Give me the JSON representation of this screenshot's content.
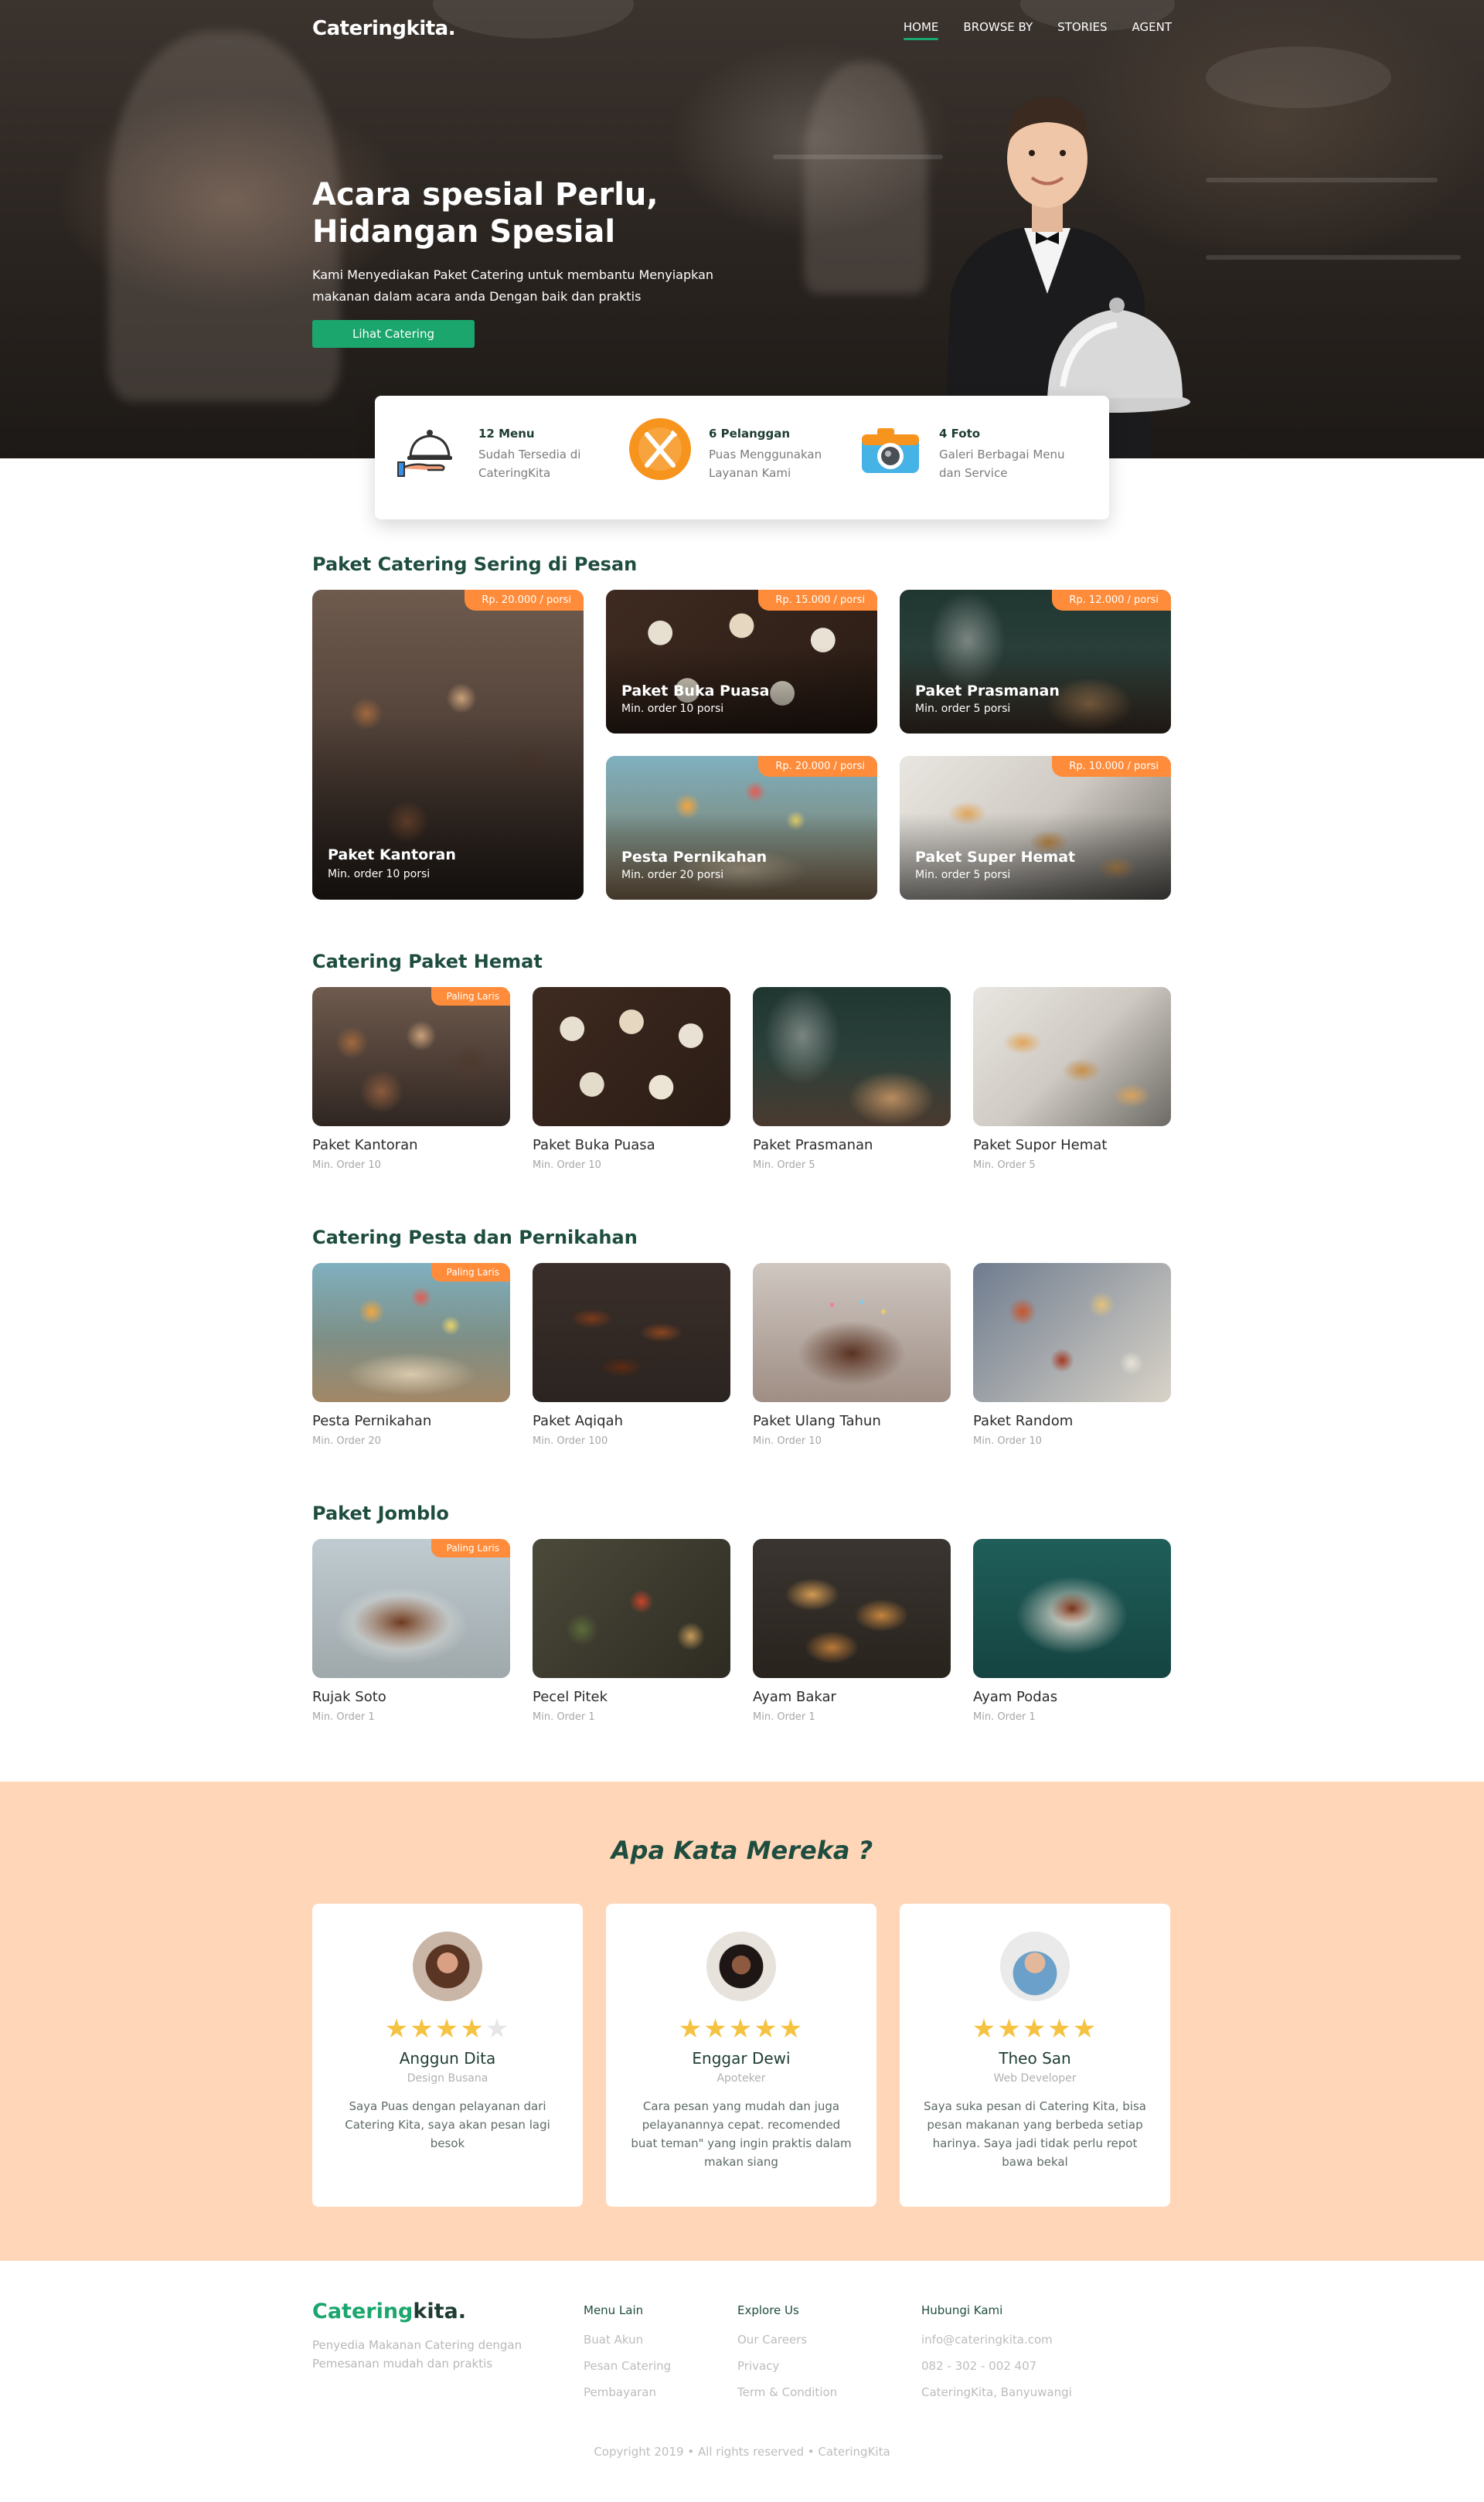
{
  "brand": "Cateringkita.",
  "nav": {
    "home": "HOME",
    "browse": "BROWSE BY",
    "stories": "STORIES",
    "agent": "AGENT"
  },
  "hero": {
    "title_line1": "Acara spesial Perlu,",
    "title_line2": "Hidangan Spesial",
    "subtitle": "Kami Menyediakan Paket Catering untuk membantu Menyiapkan makanan dalam acara anda Dengan baik dan praktis",
    "button": "Lihat Catering"
  },
  "stats": [
    {
      "title": "12 Menu",
      "text": "Sudah Tersedia di CateringKita",
      "icon": "cloche-serving-icon"
    },
    {
      "title": "6 Pelanggan",
      "text": "Puas Menggunakan Layanan Kami",
      "icon": "fork-knife-icon"
    },
    {
      "title": "4 Foto",
      "text": "Galeri Berbagai Menu dan Service",
      "icon": "camera-icon"
    }
  ],
  "popular": {
    "title": "Paket Catering Sering di Pesan",
    "items": [
      {
        "name": "Paket Kantoran",
        "min": "Min. order 10 porsi",
        "price": "Rp. 20.000 / porsi"
      },
      {
        "name": "Paket Buka Puasa",
        "min": "Min. order 10 porsi",
        "price": "Rp. 15.000 / porsi"
      },
      {
        "name": "Paket Prasmanan",
        "min": "Min. order 5 porsi",
        "price": "Rp. 12.000 / porsi"
      },
      {
        "name": "Pesta Pernikahan",
        "min": "Min. order 20 porsi",
        "price": "Rp. 20.000 / porsi"
      },
      {
        "name": "Paket Super Hemat",
        "min": "Min. order 5 porsi",
        "price": "Rp. 10.000 / porsi"
      }
    ]
  },
  "badge_laris": "Paling Laris",
  "hemat": {
    "title": "Catering Paket Hemat",
    "items": [
      {
        "name": "Paket Kantoran",
        "min": "Min. Order 10"
      },
      {
        "name": "Paket Buka Puasa",
        "min": "Min. Order 10"
      },
      {
        "name": "Paket Prasmanan",
        "min": "Min. Order 5"
      },
      {
        "name": "Paket Supor Hemat",
        "min": "Min. Order 5"
      }
    ]
  },
  "pesta": {
    "title": "Catering Pesta dan Pernikahan",
    "items": [
      {
        "name": "Pesta Pernikahan",
        "min": "Min. Order 20"
      },
      {
        "name": "Paket Aqiqah",
        "min": "Min. Order 100"
      },
      {
        "name": "Paket Ulang Tahun",
        "min": "Min. Order 10"
      },
      {
        "name": "Paket Random",
        "min": "Min. Order 10"
      }
    ]
  },
  "jomblo": {
    "title": "Paket Jomblo",
    "items": [
      {
        "name": "Rujak Soto",
        "min": "Min. Order 1"
      },
      {
        "name": "Pecel Pitek",
        "min": "Min. Order 1"
      },
      {
        "name": "Ayam Bakar",
        "min": "Min. Order 1"
      },
      {
        "name": "Ayam Podas",
        "min": "Min. Order 1"
      }
    ]
  },
  "testimonials": {
    "title": "Apa Kata Mereka ?",
    "items": [
      {
        "name": "Anggun Dita",
        "role": "Design Busana",
        "rating": 4.5,
        "text": "Saya Puas dengan pelayanan dari Catering Kita, saya akan pesan lagi besok"
      },
      {
        "name": "Enggar Dewi",
        "role": "Apoteker",
        "rating": 5,
        "text": "Cara pesan yang mudah dan juga pelayanannya cepat. recomended buat teman\" yang ingin praktis dalam makan siang"
      },
      {
        "name": "Theo San",
        "role": "Web Developer",
        "rating": 5,
        "text": "Saya suka pesan di Catering Kita, bisa pesan makanan yang berbeda setiap harinya. Saya jadi tidak perlu repot bawa bekal"
      }
    ]
  },
  "footer": {
    "brand_a": "Catering",
    "brand_b": "kita.",
    "desc": "Penyedia Makanan Catering dengan Pemesanan mudah dan praktis",
    "menu_title": "Menu Lain",
    "menu": [
      "Buat Akun",
      "Pesan Catering",
      "Pembayaran"
    ],
    "explore_title": "Explore Us",
    "explore": [
      "Our Careers",
      "Privacy",
      "Term & Condition"
    ],
    "contact_title": "Hubungi Kami",
    "contact": [
      "info@cateringkita.com",
      "082 - 302 - 002 407",
      "CateringKita, Banyuwangi"
    ],
    "copyright": "Copyright 2019 • All rights reserved • CateringKita"
  },
  "colors": {
    "green": "#1aa66d",
    "orange": "#ff8c3a",
    "peach": "#ffd6b8",
    "dark_green": "#1e4d3f"
  }
}
